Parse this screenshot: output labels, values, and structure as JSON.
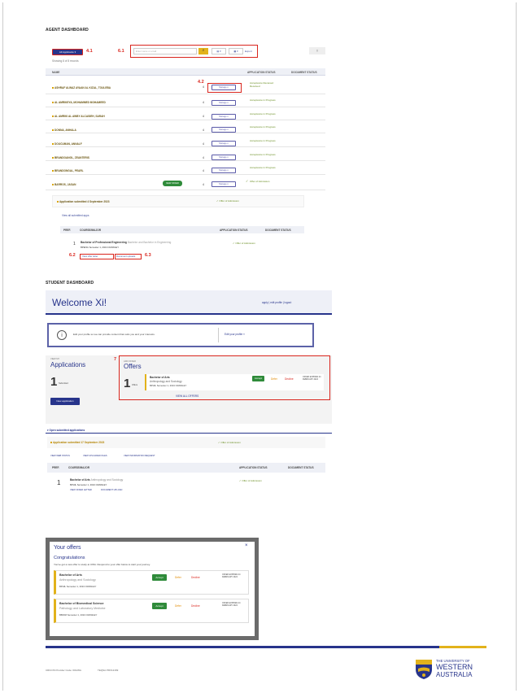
{
  "agent": {
    "title": "AGENT DASHBOARD",
    "filter_btn": "All Applicants ▾",
    "search_placeholder": "Enter name or email",
    "count": "Showing 8 of 8 records",
    "export": "Export",
    "col_name": "NAME",
    "col_app": "APPLICATION STATUS",
    "col_doc": "DOCUMENT STATUS",
    "rows": [
      {
        "name": "ASHRAF ALWAZ AYAAN AL KIZAL, TOULEBA",
        "n": "4",
        "action": "Manage ▾",
        "status": "Acceptance Received Received"
      },
      {
        "name": "AL AMRIKEYA, MOHAMMED MOHAMEED",
        "n": "4",
        "action": "Manage ▾",
        "status": "Acceptance in Progress"
      },
      {
        "name": "AL AMRIKI AL AWBY ALCASIEH, SARAH",
        "n": "4",
        "action": "Manage ▾",
        "status": "Acceptance in Progress"
      },
      {
        "name": "DONNA, ANHALA",
        "n": "4",
        "action": "Manage ▾",
        "status": "Acceptance in Progress"
      },
      {
        "name": "DOUCUMAN, ANNALF",
        "n": "4",
        "action": "Manage ▾",
        "status": "Acceptance in Progress"
      },
      {
        "name": "BRANDOANGL, ZEANTERIS",
        "n": "4",
        "action": "Manage ▾",
        "status": "Acceptance in Progress"
      },
      {
        "name": "BRANDONGAL, PEARL",
        "n": "4",
        "action": "Manage ▾",
        "status": "Acceptance in Progress"
      },
      {
        "name": "BARROS, JASAN",
        "n": "4",
        "action": "Manage ▾",
        "status": "Offer of Admission",
        "badge": "NEW OFFER"
      }
    ],
    "submitted": "Application submitted 4 September 2023",
    "submitted_status": "Offer of Admission",
    "view_link": "View all submitted apps",
    "sub_cols": [
      "PREF.",
      "COURSE/MAJOR",
      "APPLICATION STATUS",
      "DOCUMENT STATUS"
    ],
    "sub_pref": "1",
    "sub_course": "Bachelor of Professional Engineering",
    "sub_major": "Bachelor and Bachelor in Engineering",
    "sub_meta": "BPENG   Semester 1, 2024   CRAWLEY",
    "sub_status": "Offer of Admission",
    "link_letter": "View offer letter",
    "link_docs": "Document uploads",
    "labels": {
      "l41": "4.1",
      "l61": "6.1",
      "l42": "4.2",
      "l62": "6.2",
      "l63": "6.3"
    }
  },
  "student": {
    "title": "STUDENT DASHBOARD",
    "welcome": "Welcome Xi!",
    "header_links": "apply | edit profile | logout",
    "info": "Edit your profile so we can provide content that suits you and your interests.",
    "edit_profile": "Edit your profile »",
    "apps_label": "VIEW MY",
    "apps_title": "Applications",
    "apps_count": "1",
    "apps_sub": "Submitted",
    "new_app": "New application",
    "offers_label": "ADD OFFER",
    "offers_title": "Offers",
    "offer_count": "1",
    "offer_count_sub": "Offers",
    "offer_course": "Bachelor of Arts",
    "offer_major": "Anthropology and Sociology",
    "offer_meta": "BPHIL   Semester 1, 2024   CRAWLEY",
    "accept": "Accept",
    "defer": "Defer",
    "decline": "Decline",
    "expiry": "OFFER EXPIRES 24 FEBRUARY 2024",
    "view_offers": "VIEW ALL OFFERS",
    "label7": "7",
    "open_submitted": "Open submitted applications",
    "app_sub": "Application submitted 17 September 2023",
    "app_sub_status": "Offer of Admission",
    "links": [
      "VIEW WEB STATUS",
      "VIEW UPLOADED FILES",
      "VIEW INFORMATION REQUEST"
    ],
    "cols": [
      "PREF.",
      "COURSE/MAJOR",
      "APPLICATION STATUS",
      "DOCUMENT STATUS"
    ],
    "pref": "1",
    "course": "Bachelor of Arts",
    "major": "Anthropology and Sociology",
    "meta": "BPHIL   Semester 1, 2024   CRAWLEY",
    "status": "Offer of Admission",
    "link_a": "VIEW OFFER LETTER",
    "link_b": "DOCUMENT UPLOAD"
  },
  "modal": {
    "title": "Your offers",
    "close": "×",
    "congrats": "Congratulations",
    "text": "You've got a new offer to study at UWA. Respond to your offer below to start your journey.",
    "offers": [
      {
        "course": "Bachelor of Arts",
        "major": "Anthropology and Sociology",
        "meta": "BPHIL   Semester 1, 2024   CRAWLEY",
        "expiry": "OFFER EXPIRES 24 FEBRUARY 2024"
      },
      {
        "course": "Bachelor of Biomedical Science",
        "major": "Pathology and Laboratory Medicine",
        "meta": "BBIOM   Semester 1, 2024   CRAWLEY",
        "expiry": "OFFER EXPIRES 24 FEBRUARY 2024"
      }
    ],
    "accept": "Accept",
    "defer": "Defer",
    "decline": "Decline"
  },
  "footer": {
    "cricos": "CRICOS Provider Code: 00126G",
    "teqsa": "TEQSA PRV12169",
    "uni_line1": "THE UNIVERSITY OF",
    "uni_line2": "WESTERN",
    "uni_line3": "AUSTRALIA"
  },
  "colors": {
    "accent": "#d9251d",
    "uwa_blue": "#27348b",
    "gold": "#e2b21b"
  }
}
